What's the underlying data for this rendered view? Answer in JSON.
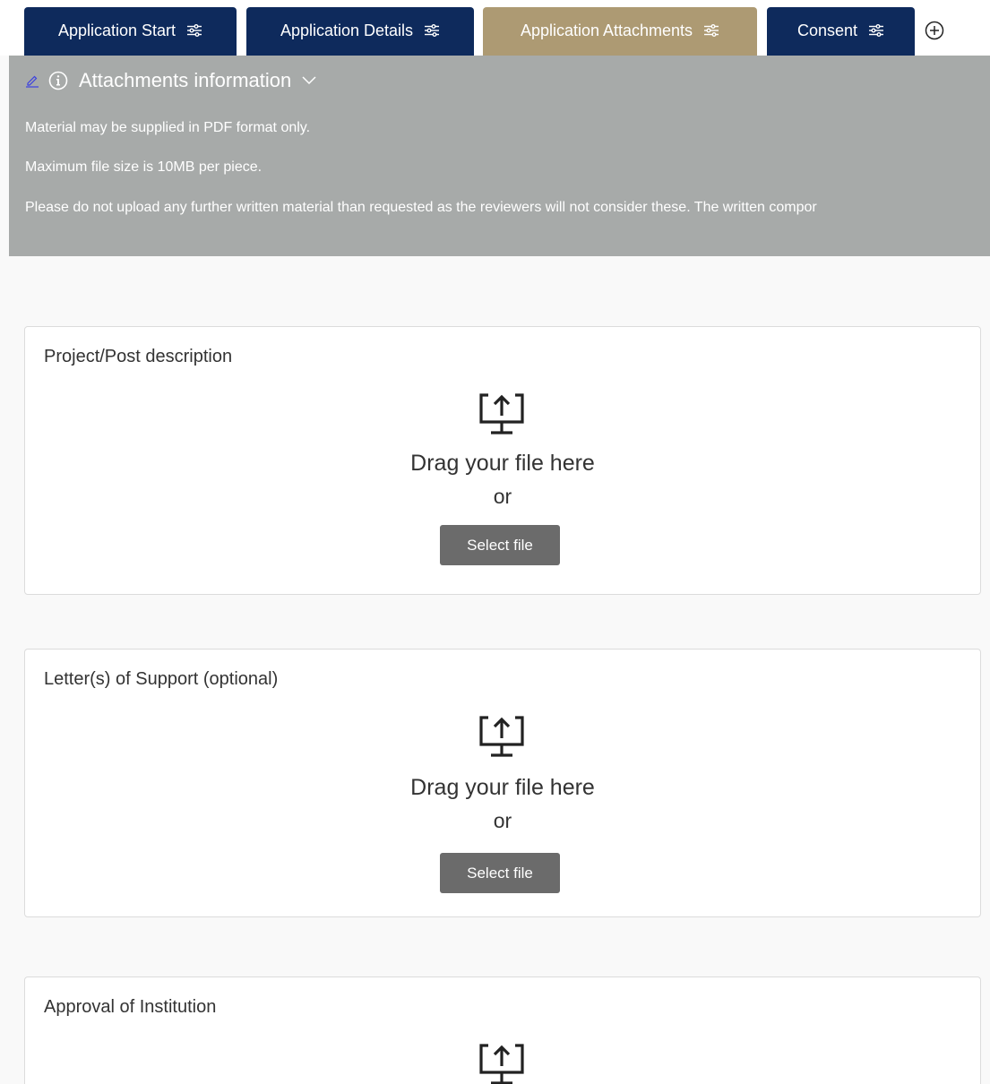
{
  "tabs": [
    {
      "label": "Application Start",
      "active": false,
      "icon": "sliders-icon"
    },
    {
      "label": "Application Details",
      "active": false,
      "icon": "sliders-icon"
    },
    {
      "label": "Application Attachments",
      "active": true,
      "icon": "sliders-icon"
    },
    {
      "label": "Consent",
      "active": false,
      "icon": "sliders-icon"
    }
  ],
  "add_tab_icon": "plus-circle-icon",
  "info_panel": {
    "title": "Attachments information",
    "lines": [
      "Material may be supplied in PDF format only.",
      "Maximum file size is 10MB per piece.",
      "Please do not upload any further written material than requested as the reviewers will not consider these. The written compor"
    ]
  },
  "uploads": [
    {
      "title": "Project/Post description",
      "drag_text": "Drag your file here",
      "or_text": "or",
      "button": "Select file"
    },
    {
      "title": "Letter(s) of Support (optional)",
      "drag_text": "Drag your file here",
      "or_text": "or",
      "button": "Select file"
    },
    {
      "title": "Approval of Institution"
    }
  ],
  "colors": {
    "tab_dark": "#0e2a5c",
    "tab_active": "#ad9a73",
    "info_panel_bg": "#a7aaa9",
    "button_bg": "#6b6b6b",
    "page_bg": "#f9f9f9"
  }
}
